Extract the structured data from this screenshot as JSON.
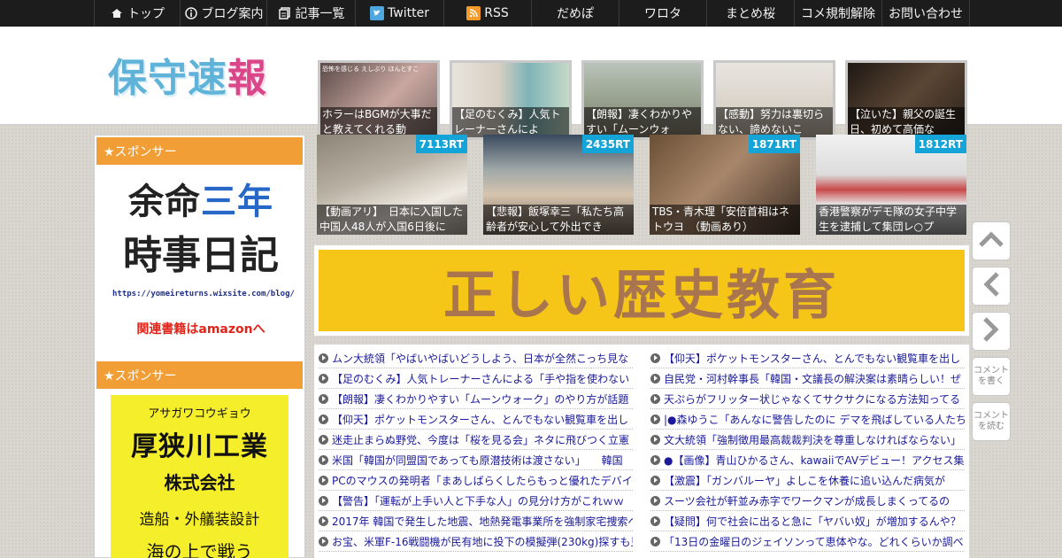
{
  "nav": {
    "items": [
      {
        "label": "トップ",
        "icon": "home-icon"
      },
      {
        "label": "ブログ案内",
        "icon": "info-icon"
      },
      {
        "label": "記事一覧",
        "icon": "list-icon"
      },
      {
        "label": "Twitter",
        "icon": "twitter-icon"
      },
      {
        "label": "RSS",
        "icon": "rss-icon"
      },
      {
        "label": "だめぽ",
        "icon": ""
      },
      {
        "label": "ワロタ",
        "icon": ""
      },
      {
        "label": "まとめ桜",
        "icon": ""
      },
      {
        "label": "コメ規制解除",
        "icon": ""
      },
      {
        "label": "お問い合わせ",
        "icon": ""
      }
    ]
  },
  "logo": {
    "c1": "保守",
    "c2": "速",
    "c3": "報"
  },
  "header_thumbs": [
    {
      "caption": "ホラーはBGMが大事だと教えてくれる動",
      "overlay": "恐怖を感じる  えしぶり    ほんとすこ"
    },
    {
      "caption": "【足のむくみ】人気トレーナーさんによ",
      "overlay": ""
    },
    {
      "caption": "【朗報】凄くわかりやすい「ムーンウォ",
      "overlay": ""
    },
    {
      "caption": "【感動】努力は裏切らない、諦めないこ",
      "overlay": ""
    },
    {
      "caption": "【泣いた】親父の誕生日、初めて高価な",
      "overlay": ""
    }
  ],
  "sidebar": {
    "sponsor_label": "★スポンサー",
    "ad1": {
      "line1a": "余命",
      "line1b": "三年",
      "line2": "時事日記",
      "url": "https://yomeireturns.wixsite.com/blog/",
      "amazon": "関連書籍はamazonへ"
    },
    "sponsor_label2": "★スポンサー",
    "ad2": {
      "kana": "アサガワコウギョウ",
      "name": "厚狭川工業",
      "corp": "株式会社",
      "biz": "造船・外艤装設計",
      "more": "海の上で戦う"
    }
  },
  "rt_cards": [
    {
      "rt": "7113RT",
      "caption": "【動画アリ】　日本に入国した中国人48人が入国6日後に"
    },
    {
      "rt": "2435RT",
      "caption": "【悲報】飯塚幸三「私たち高齢者が安心して外出でき"
    },
    {
      "rt": "1871RT",
      "caption": "TBS・青木理「安倍首相はネトウヨ　（動画あり）"
    },
    {
      "rt": "1812RT",
      "caption": "香港警察がデモ隊の女子中学生を逮捕して集団レ○プ"
    }
  ],
  "banner": {
    "text": "正しい歴史教育"
  },
  "links_left": [
    "ムン大統領「やばいやばいどうしよう、日本が全然こっち見な",
    "【足のむくみ】人気トレーナーさんによる「手や指を使わない",
    "【朗報】凄くわかりやすい「ムーンウォーク」のやり方が話題",
    "【仰天】ポケットモンスターさん、とんでもない観覧車を出し",
    "迷走止まらぬ野党、今度は「桜を見る会」ネタに飛びつく立憲",
    "米国「韓国が同盟国であっても原潜技術は渡さない」　　韓国",
    "PCのマウスの発明者「まあしばらくしたらもっと優れたデバイ",
    "【警告】「運転が上手い人と下手な人」の見分け方がこれｗｗ",
    "2017年 韓国で発生した地震、地熱発電事業所を強制家宅捜索へ",
    "お宝、米軍F-16戦闘機が民有地に投下の模擬弾(230kg)探すも見"
  ],
  "links_right": [
    "【仰天】ポケットモンスターさん、とんでもない観覧車を出し",
    "自民党・河村幹事長「韓国・文議長の解決案は素晴らしい！ぜ",
    "天ぷらがフリッター状じゃなくてサクサクになる方法知ってる",
    "|●森ゆうこ「あんなに警告したのに デマを飛ばしている人たち",
    "文大統領「強制徴用最高裁裁判決を尊重しなければならない」",
    "●【画像】青山ひかるさん、kawaiiでAVデビュー！アクセス集中",
    "【激震】「ガンバルーヤ」よしこを休養に追い込んだ病気が",
    "スーツ会社が軒並み赤字でワークマンが成長しまくってるの",
    "【疑問】何で社会に出ると急に「ヤバい奴」が増加するんや？",
    "「13日の金曜日のジェイソンって恵体やな。どれくらいか調べ"
  ],
  "floatbar": {
    "comment_write": "コメントを書く",
    "comment_read": "コメントを読む"
  },
  "colors": {
    "nav_bg": "#1c1c1c",
    "sponsor_orange": "#f19e36",
    "rt_badge": "#15a4d8",
    "banner_yellow": "#f5c518",
    "ad2_yellow": "#f5ee2a"
  }
}
